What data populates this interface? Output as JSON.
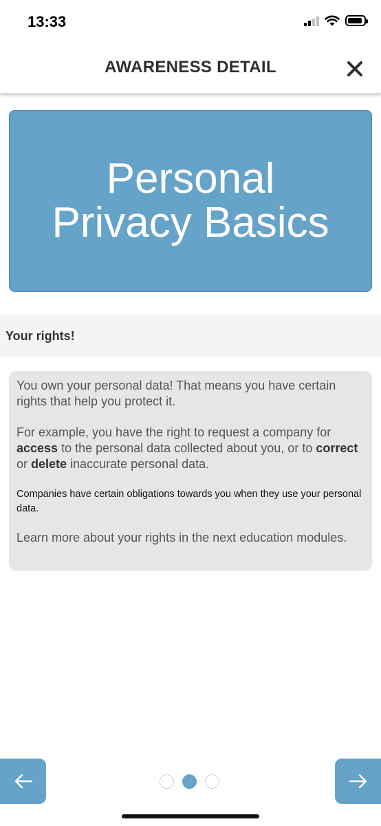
{
  "status_bar": {
    "time": "13:33",
    "icons": [
      "signal-icon",
      "wifi-icon",
      "battery-icon"
    ]
  },
  "header": {
    "title": "AWARENESS DETAIL",
    "close_icon": "close-icon"
  },
  "banner": {
    "title": "Personal\nPrivacy Basics",
    "color": "#66a3c9"
  },
  "section": {
    "title": "Your rights!"
  },
  "content": {
    "p1": "You own your personal data! That means you have certain rights that help you protect it.",
    "p2": {
      "t1": "For example, you have the right to request a company for ",
      "b1": "access",
      "t2": " to the personal data collected about you, or to ",
      "b2": "correct",
      "t3": " or ",
      "b3": "delete",
      "t4": " inaccurate personal data."
    },
    "p3": "Companies have certain obligations towards you when they use your personal data.",
    "p4": "Learn more about your rights in the next education modules."
  },
  "navigation": {
    "prev_icon": "arrow-left-icon",
    "next_icon": "arrow-right-icon",
    "total_pages": 3,
    "current_page": 2
  },
  "colors": {
    "accent": "#66a3c9",
    "card_bg": "#e6e6e6",
    "section_bg": "#f4f4f4"
  }
}
